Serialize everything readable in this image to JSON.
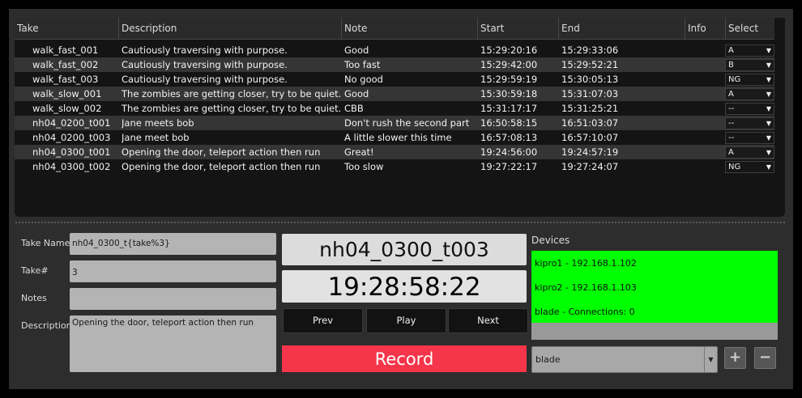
{
  "table": {
    "columns": [
      "Take",
      "Description",
      "Note",
      "Start",
      "End",
      "Info",
      "Select"
    ],
    "rows": [
      {
        "take": "walk_fast_001",
        "description": "Cautiously traversing with purpose.",
        "note": "Good",
        "start": "15:29:20:16",
        "end": "15:29:33:06",
        "info": "",
        "select": "A"
      },
      {
        "take": "walk_fast_002",
        "description": "Cautiously traversing with purpose.",
        "note": "Too fast",
        "start": "15:29:42:00",
        "end": "15:29:52:21",
        "info": "",
        "select": "B"
      },
      {
        "take": "walk_fast_003",
        "description": "Cautiously traversing with purpose.",
        "note": "No good",
        "start": "15:29:59:19",
        "end": "15:30:05:13",
        "info": "",
        "select": "NG"
      },
      {
        "take": "walk_slow_001",
        "description": "The zombies are getting closer, try to be quiet.",
        "note": "Good",
        "start": "15:30:59:18",
        "end": "15:31:07:03",
        "info": "",
        "select": "A"
      },
      {
        "take": "walk_slow_002",
        "description": "The zombies are getting closer, try to be quiet.",
        "note": "CBB",
        "start": "15:31:17:17",
        "end": "15:31:25:21",
        "info": "",
        "select": "--"
      },
      {
        "take": "nh04_0200_t001",
        "description": "Jane meets bob",
        "note": "Don't rush the second part",
        "start": "16:50:58:15",
        "end": "16:51:03:07",
        "info": "",
        "select": "--"
      },
      {
        "take": "nh04_0200_t003",
        "description": "Jane meet bob",
        "note": "A little slower this time",
        "start": "16:57:08:13",
        "end": "16:57:10:07",
        "info": "",
        "select": "--"
      },
      {
        "take": "nh04_0300_t001",
        "description": "Opening the door, teleport action then run",
        "note": "Great!",
        "start": "19:24:56:00",
        "end": "19:24:57:19",
        "info": "",
        "select": "A"
      },
      {
        "take": "nh04_0300_t002",
        "description": "Opening the door, teleport action then run",
        "note": "Too slow",
        "start": "19:27:22:17",
        "end": "19:27:24:07",
        "info": "",
        "select": "NG"
      }
    ]
  },
  "form": {
    "take_name_label": "Take Name",
    "take_name_value": "nh04_0300_t{take%3}",
    "take_num_label": "Take#",
    "take_num_value": "3",
    "notes_label": "Notes",
    "notes_value": "",
    "description_label": "Description",
    "description_value": "Opening the door, teleport action then run"
  },
  "transport": {
    "current_take": "nh04_0300_t003",
    "timecode": "19:28:58:22",
    "prev_label": "Prev",
    "play_label": "Play",
    "next_label": "Next",
    "record_label": "Record",
    "record_color": "#f4354a"
  },
  "devices": {
    "title": "Devices",
    "items": [
      "kipro1 - 192.168.1.102",
      "kipro2 - 192.168.1.103",
      "blade - Connections: 0"
    ],
    "status_color": "#00ff00",
    "selected": "blade",
    "add_icon": "plus-icon",
    "remove_icon": "minus-icon"
  }
}
